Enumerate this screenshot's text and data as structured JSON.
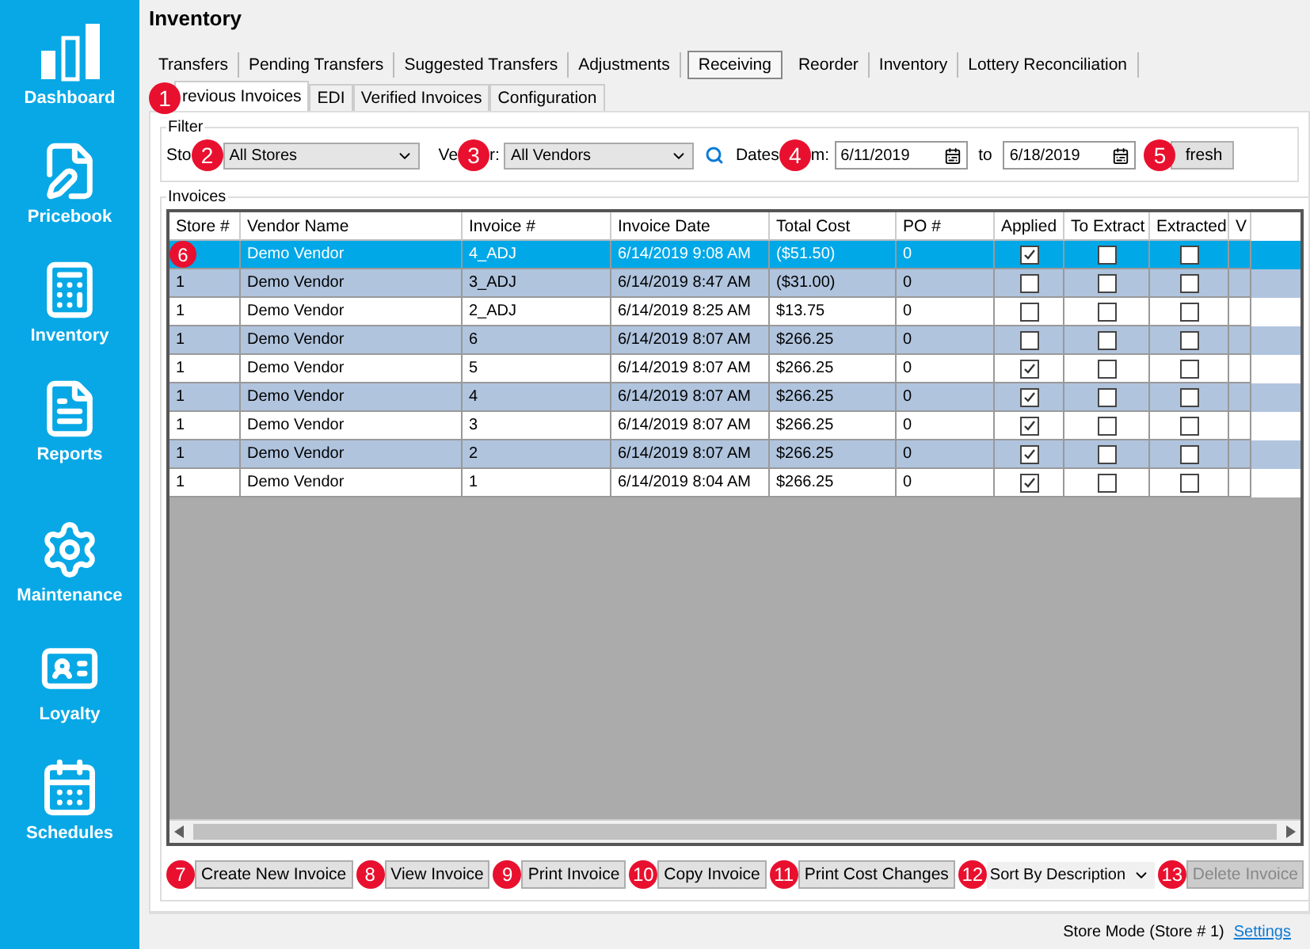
{
  "sidebar": {
    "items": [
      {
        "label": "Dashboard",
        "kind": "chart"
      },
      {
        "label": "Pricebook",
        "kind": "pricebook"
      },
      {
        "label": "Inventory",
        "kind": "calculator"
      },
      {
        "label": "Reports",
        "kind": "report"
      },
      {
        "label": "Maintenance",
        "kind": "gear"
      },
      {
        "label": "Loyalty",
        "kind": "card"
      },
      {
        "label": "Schedules",
        "kind": "calendar"
      }
    ]
  },
  "title": "Inventory",
  "tabs": [
    {
      "label": "Transfers",
      "selected": false
    },
    {
      "label": "Pending Transfers",
      "selected": false
    },
    {
      "label": "Suggested Transfers",
      "selected": false
    },
    {
      "label": "Adjustments",
      "selected": false
    },
    {
      "label": "Receiving",
      "selected": true
    },
    {
      "label": "Reorder",
      "selected": false
    },
    {
      "label": "Inventory",
      "selected": false
    },
    {
      "label": "Lottery Reconciliation",
      "selected": false
    }
  ],
  "subtabs": [
    {
      "label": "revious Invoices",
      "selected": true,
      "badge": "1"
    },
    {
      "label": "EDI",
      "selected": false
    },
    {
      "label": "Verified Invoices",
      "selected": false
    },
    {
      "label": "Configuration",
      "selected": false
    }
  ],
  "filter": {
    "legend": "Filter",
    "store_label": "Sto",
    "store_badge": "2",
    "store_value": "All Stores",
    "vendor_label": "Ve",
    "vendor_badge": "3",
    "vendor_label_end": "r:",
    "vendor_value": "All Vendors",
    "dates_label": "Dates",
    "dates_badge": "4",
    "dates_label_end": "m:",
    "date_from": "6/11/2019",
    "to_label": "to",
    "date_to": "6/18/2019",
    "refresh_badge": "5",
    "refresh_label": "fresh"
  },
  "invoices": {
    "legend": "Invoices",
    "row_badge": "6",
    "columns": [
      "Store #",
      "Vendor Name",
      "Invoice #",
      "Invoice Date",
      "Total Cost",
      "PO #",
      "Applied",
      "To Extract",
      "Extracted",
      "V"
    ],
    "rows": [
      {
        "vendor": "Demo Vendor",
        "invoice": "4_ADJ",
        "date": "6/14/2019 9:08 AM",
        "total": "($51.50)",
        "po": "0",
        "applied": true,
        "to_extract": false,
        "extracted": false,
        "selected": true
      },
      {
        "store": "1",
        "vendor": "Demo Vendor",
        "invoice": "3_ADJ",
        "date": "6/14/2019 8:47 AM",
        "total": "($31.00)",
        "po": "0",
        "applied": false,
        "to_extract": false,
        "extracted": false,
        "selected": false
      },
      {
        "store": "1",
        "vendor": "Demo Vendor",
        "invoice": "2_ADJ",
        "date": "6/14/2019 8:25 AM",
        "total": "$13.75",
        "po": "0",
        "applied": false,
        "to_extract": false,
        "extracted": false,
        "selected": false
      },
      {
        "store": "1",
        "vendor": "Demo Vendor",
        "invoice": "6",
        "date": "6/14/2019 8:07 AM",
        "total": "$266.25",
        "po": "0",
        "applied": false,
        "to_extract": false,
        "extracted": false,
        "selected": false
      },
      {
        "store": "1",
        "vendor": "Demo Vendor",
        "invoice": "5",
        "date": "6/14/2019 8:07 AM",
        "total": "$266.25",
        "po": "0",
        "applied": true,
        "to_extract": false,
        "extracted": false,
        "selected": false
      },
      {
        "store": "1",
        "vendor": "Demo Vendor",
        "invoice": "4",
        "date": "6/14/2019 8:07 AM",
        "total": "$266.25",
        "po": "0",
        "applied": true,
        "to_extract": false,
        "extracted": false,
        "selected": false
      },
      {
        "store": "1",
        "vendor": "Demo Vendor",
        "invoice": "3",
        "date": "6/14/2019 8:07 AM",
        "total": "$266.25",
        "po": "0",
        "applied": true,
        "to_extract": false,
        "extracted": false,
        "selected": false
      },
      {
        "store": "1",
        "vendor": "Demo Vendor",
        "invoice": "2",
        "date": "6/14/2019 8:07 AM",
        "total": "$266.25",
        "po": "0",
        "applied": true,
        "to_extract": false,
        "extracted": false,
        "selected": false
      },
      {
        "store": "1",
        "vendor": "Demo Vendor",
        "invoice": "1",
        "date": "6/14/2019 8:04 AM",
        "total": "$266.25",
        "po": "0",
        "applied": true,
        "to_extract": false,
        "extracted": false,
        "selected": false
      }
    ]
  },
  "actions": [
    {
      "label": "Create New Invoice",
      "badge": "7",
      "kind": "button",
      "disabled": false
    },
    {
      "label": "View Invoice",
      "badge": "8",
      "kind": "button",
      "disabled": false
    },
    {
      "label": "Print Invoice",
      "badge": "9",
      "kind": "button",
      "disabled": false
    },
    {
      "label": "Copy Invoice",
      "badge": "10",
      "kind": "button",
      "disabled": false
    },
    {
      "label": "Print Cost Changes",
      "badge": "11",
      "kind": "button",
      "disabled": false
    },
    {
      "label": "Sort By Description",
      "badge": "12",
      "kind": "dropdown",
      "disabled": false
    },
    {
      "label": "Delete Invoice",
      "badge": "13",
      "kind": "button",
      "disabled": true
    }
  ],
  "status_bar": {
    "text": "Store Mode (Store # 1)",
    "link": "Settings"
  }
}
